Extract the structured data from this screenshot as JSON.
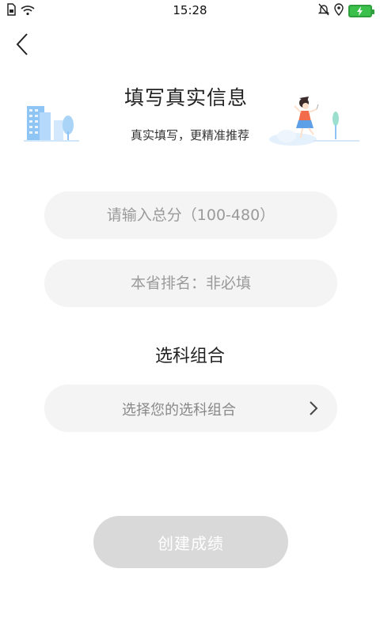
{
  "status_bar": {
    "time": "15:28"
  },
  "header": {
    "title": "填写真实信息",
    "subtitle": "真实填写，更精准推荐"
  },
  "form": {
    "score_placeholder": "请输入总分（100-480）",
    "rank_placeholder": "本省排名：非必填",
    "subject_section_label": "选科组合",
    "subject_select_placeholder": "选择您的选科组合"
  },
  "actions": {
    "create_label": "创建成绩"
  },
  "colors": {
    "field_bg": "#f4f4f4",
    "button_disabled_bg": "#d9d9d9",
    "battery": "#3cc04c",
    "illustration_blue": "#8ec5f5"
  },
  "icons": [
    "sim-icon",
    "wifi-icon",
    "mute-bell-icon",
    "location-icon",
    "battery-icon",
    "back-chevron-icon",
    "chevron-right-icon"
  ]
}
